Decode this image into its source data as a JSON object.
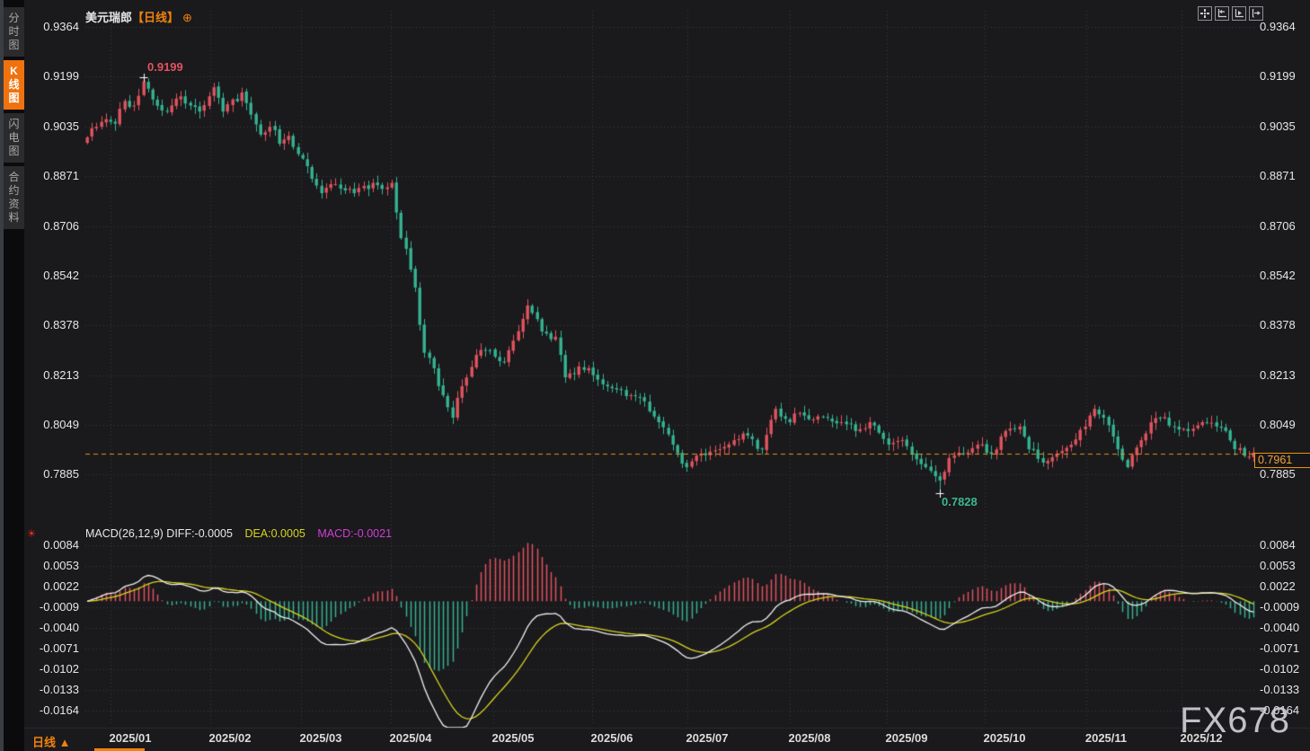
{
  "header": {
    "symbol": "美元瑞郎",
    "period_tag": "【日线】",
    "gear_icon": "⊕"
  },
  "sidebar": {
    "tabs": [
      {
        "label": "分时图",
        "active": false
      },
      {
        "label": "K线图",
        "active": true
      },
      {
        "label": "闪电图",
        "active": false
      },
      {
        "label": "合约资料",
        "active": false
      }
    ]
  },
  "toolbar": {
    "icons": [
      "pan-icon",
      "scale-left-icon",
      "auto-play-icon",
      "go-latest-icon"
    ]
  },
  "macd": {
    "label_diff": "MACD(26,12,9) DIFF:-0.0005",
    "label_dea": "DEA:0.0005",
    "label_macd": "MACD:-0.0021",
    "settings_icon": "☀"
  },
  "footer": {
    "period_label": "日线 ▲"
  },
  "watermark": "FX678",
  "annotations": {
    "high_label": "0.9199",
    "low_label": "0.7828",
    "last_price_label": "0.7961"
  },
  "colors": {
    "up": "#e0545f",
    "down": "#35b492",
    "diff_line": "#f0f0f0",
    "dea_line": "#d6d41e",
    "grid": "#3a3a3e",
    "accent_orange": "#f0820e",
    "price_line": "#e8930c",
    "background": "#1a191c"
  },
  "chart_data": {
    "type": "candlestick+macd",
    "title": "美元瑞郎 日线 (USD/CHF daily)",
    "price_axis_ticks": [
      "0.9364",
      "0.9199",
      "0.9035",
      "0.8871",
      "0.8706",
      "0.8542",
      "0.8378",
      "0.8213",
      "0.8049",
      "0.7885"
    ],
    "price_axis_top_value": 0.9364,
    "price_axis_tick_step": 0.0164,
    "x_labels": [
      "2025/01",
      "2025/02",
      "2025/03",
      "2025/04",
      "2025/05",
      "2025/06",
      "2025/07",
      "2025/08",
      "2025/09",
      "2025/10",
      "2025/11",
      "2025/12"
    ],
    "marked_high": 0.9199,
    "marked_low": 0.7828,
    "last_price": 0.7961,
    "candle_count": 250,
    "price_path_anchors": [
      [
        0,
        0.9
      ],
      [
        2,
        0.9035
      ],
      [
        4,
        0.906
      ],
      [
        6,
        0.9045
      ],
      [
        8,
        0.912
      ],
      [
        10,
        0.9105
      ],
      [
        12,
        0.9185
      ],
      [
        14,
        0.9125
      ],
      [
        17,
        0.9085
      ],
      [
        20,
        0.9135
      ],
      [
        22,
        0.9105
      ],
      [
        24,
        0.9085
      ],
      [
        27,
        0.9165
      ],
      [
        29,
        0.9085
      ],
      [
        31,
        0.9125
      ],
      [
        33,
        0.9148
      ],
      [
        35,
        0.9075
      ],
      [
        37,
        0.9009
      ],
      [
        39,
        0.9035
      ],
      [
        41,
        0.8979
      ],
      [
        43,
        0.9005
      ],
      [
        45,
        0.8945
      ],
      [
        47,
        0.8905
      ],
      [
        50,
        0.8816
      ],
      [
        53,
        0.8846
      ],
      [
        55,
        0.8825
      ],
      [
        57,
        0.8816
      ],
      [
        59,
        0.884
      ],
      [
        61,
        0.885
      ],
      [
        63,
        0.883
      ],
      [
        65,
        0.885
      ],
      [
        67,
        0.8668
      ],
      [
        69,
        0.8564
      ],
      [
        70,
        0.8505
      ],
      [
        72,
        0.829
      ],
      [
        74,
        0.8239
      ],
      [
        75,
        0.818
      ],
      [
        76,
        0.815
      ],
      [
        78,
        0.8076
      ],
      [
        80,
        0.818
      ],
      [
        83,
        0.8283
      ],
      [
        86,
        0.8298
      ],
      [
        89,
        0.8259
      ],
      [
        91,
        0.833
      ],
      [
        94,
        0.8446
      ],
      [
        97,
        0.836
      ],
      [
        100,
        0.8343
      ],
      [
        102,
        0.8209
      ],
      [
        105,
        0.8245
      ],
      [
        108,
        0.8216
      ],
      [
        112,
        0.8173
      ],
      [
        116,
        0.815
      ],
      [
        119,
        0.813
      ],
      [
        122,
        0.8061
      ],
      [
        125,
        0.7987
      ],
      [
        128,
        0.7913
      ],
      [
        131,
        0.7957
      ],
      [
        135,
        0.7972
      ],
      [
        138,
        0.8002
      ],
      [
        141,
        0.8017
      ],
      [
        144,
        0.7972
      ],
      [
        147,
        0.8105
      ],
      [
        150,
        0.8061
      ],
      [
        152,
        0.8091
      ],
      [
        155,
        0.807
      ],
      [
        158,
        0.8076
      ],
      [
        161,
        0.8061
      ],
      [
        164,
        0.8032
      ],
      [
        167,
        0.8061
      ],
      [
        171,
        0.7987
      ],
      [
        174,
        0.8002
      ],
      [
        176,
        0.7957
      ],
      [
        179,
        0.7913
      ],
      [
        182,
        0.7869
      ],
      [
        184,
        0.7943
      ],
      [
        187,
        0.7957
      ],
      [
        190,
        0.7987
      ],
      [
        193,
        0.7957
      ],
      [
        196,
        0.8032
      ],
      [
        199,
        0.8047
      ],
      [
        201,
        0.7972
      ],
      [
        204,
        0.7928
      ],
      [
        207,
        0.7957
      ],
      [
        210,
        0.7987
      ],
      [
        213,
        0.8047
      ],
      [
        215,
        0.8105
      ],
      [
        217,
        0.8076
      ],
      [
        220,
        0.7972
      ],
      [
        222,
        0.7913
      ],
      [
        225,
        0.8002
      ],
      [
        227,
        0.8061
      ],
      [
        229,
        0.8076
      ],
      [
        232,
        0.8047
      ],
      [
        235,
        0.8032
      ],
      [
        238,
        0.8061
      ],
      [
        241,
        0.8047
      ],
      [
        243,
        0.8032
      ],
      [
        245,
        0.7972
      ],
      [
        247,
        0.795
      ],
      [
        249,
        0.7961
      ]
    ],
    "high_override_index": 12,
    "low_override_index": 182,
    "macd_axis_ticks": [
      "0.0084",
      "0.0053",
      "0.0022",
      "-0.0009",
      "-0.0040",
      "-0.0071",
      "-0.0102",
      "-0.0133",
      "-0.0164"
    ],
    "macd_axis_top_value": 0.0084,
    "macd_axis_tick_step": 0.0031,
    "macd_last": {
      "diff": -0.0005,
      "dea": 0.0005,
      "bar": -0.0021
    },
    "legend_note": "red bars = bullish candles, green bars = bearish candles (CN convention)"
  }
}
